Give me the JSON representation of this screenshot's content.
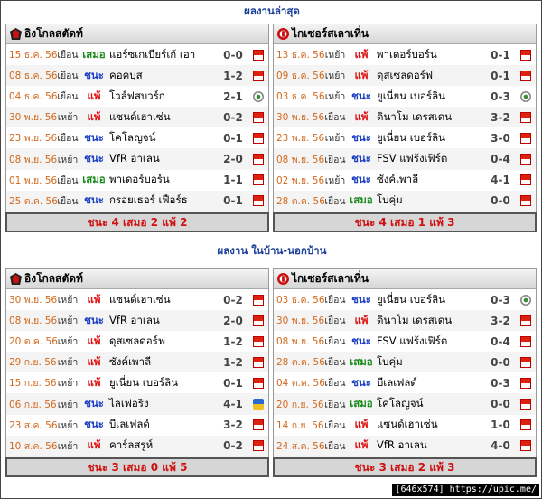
{
  "section1": {
    "title": "ผลงานล่าสุด",
    "left": {
      "team": "อิงโกลสตัดท์",
      "summary": "ชนะ 4 เสมอ 2 แพ้ 2",
      "rows": [
        {
          "date": "15 ธ.ค. 56",
          "venue": "เยือน",
          "result": "เสมอ",
          "rtype": "draw",
          "opponent": "แอร์ซเกเบียร์เก้ เอา",
          "score": "0-0",
          "comp": "bl"
        },
        {
          "date": "08 ธ.ค. 56",
          "venue": "เยือน",
          "result": "ชนะ",
          "rtype": "win",
          "opponent": "คอคบุส",
          "score": "1-2",
          "comp": "bl"
        },
        {
          "date": "04 ธ.ค. 56",
          "venue": "เยือน",
          "result": "แพ้",
          "rtype": "loss",
          "opponent": "โวล์ฟสบวร์ก",
          "score": "2-1",
          "comp": "cup"
        },
        {
          "date": "30 พ.ย. 56",
          "venue": "เหย้า",
          "result": "แพ้",
          "rtype": "loss",
          "opponent": "แซนด์เฮาเซ่น",
          "score": "0-2",
          "comp": "bl"
        },
        {
          "date": "23 พ.ย. 56",
          "venue": "เยือน",
          "result": "ชนะ",
          "rtype": "win",
          "opponent": "โคโลญจน์",
          "score": "0-1",
          "comp": "bl"
        },
        {
          "date": "08 พ.ย. 56",
          "venue": "เหย้า",
          "result": "ชนะ",
          "rtype": "win",
          "opponent": "VfR อาเลน",
          "score": "2-0",
          "comp": "bl"
        },
        {
          "date": "01 พ.ย. 56",
          "venue": "เยือน",
          "result": "เสมอ",
          "rtype": "draw",
          "opponent": "พาเดอร์บอร์น",
          "score": "1-1",
          "comp": "bl"
        },
        {
          "date": "25 ต.ค. 56",
          "venue": "เยือน",
          "result": "ชนะ",
          "rtype": "win",
          "opponent": "กรอยเธอร์ เฟือร์ธ",
          "score": "0-1",
          "comp": "bl"
        }
      ]
    },
    "right": {
      "team": "ไกเซอร์สเลาเทิ่น",
      "summary": "ชนะ 4 เสมอ 1 แพ้ 3",
      "rows": [
        {
          "date": "13 ธ.ค. 56",
          "venue": "เหย้า",
          "result": "แพ้",
          "rtype": "loss",
          "opponent": "พาเดอร์บอร์น",
          "score": "0-1",
          "comp": "bl"
        },
        {
          "date": "09 ธ.ค. 56",
          "venue": "เหย้า",
          "result": "แพ้",
          "rtype": "loss",
          "opponent": "ดุสเซลดอร์ฟ",
          "score": "0-1",
          "comp": "bl"
        },
        {
          "date": "03 ธ.ค. 56",
          "venue": "เหย้า",
          "result": "ชนะ",
          "rtype": "win",
          "opponent": "ยูเนี่ยน เบอร์ลิน",
          "score": "0-3",
          "comp": "cup"
        },
        {
          "date": "30 พ.ย. 56",
          "venue": "เยือน",
          "result": "แพ้",
          "rtype": "loss",
          "opponent": "ดินาโม เดรสเดน",
          "score": "3-2",
          "comp": "bl"
        },
        {
          "date": "23 พ.ย. 56",
          "venue": "เหย้า",
          "result": "ชนะ",
          "rtype": "win",
          "opponent": "ยูเนี่ยน เบอร์ลิน",
          "score": "3-0",
          "comp": "bl"
        },
        {
          "date": "08 พ.ย. 56",
          "venue": "เยือน",
          "result": "ชนะ",
          "rtype": "win",
          "opponent": "FSV แฟร้งเฟิร์ต",
          "score": "0-4",
          "comp": "bl"
        },
        {
          "date": "02 พ.ย. 56",
          "venue": "เหย้า",
          "result": "ชนะ",
          "rtype": "win",
          "opponent": "ซังค์เพาลี",
          "score": "4-1",
          "comp": "bl"
        },
        {
          "date": "28 ต.ค. 56",
          "venue": "เยือน",
          "result": "เสมอ",
          "rtype": "draw",
          "opponent": "โบคุ่ม",
          "score": "0-0",
          "comp": "bl"
        }
      ]
    }
  },
  "section2": {
    "title": "ผลงาน ในบ้าน-นอกบ้าน",
    "left": {
      "team": "อิงโกลสตัดท์",
      "summary": "ชนะ 3 เสมอ 0 แพ้ 5",
      "rows": [
        {
          "date": "30 พ.ย. 56",
          "venue": "เหย้า",
          "result": "แพ้",
          "rtype": "loss",
          "opponent": "แซนด์เฮาเซ่น",
          "score": "0-2",
          "comp": "bl"
        },
        {
          "date": "08 พ.ย. 56",
          "venue": "เหย้า",
          "result": "ชนะ",
          "rtype": "win",
          "opponent": "VfR อาเลน",
          "score": "2-0",
          "comp": "bl"
        },
        {
          "date": "20 ต.ค. 56",
          "venue": "เหย้า",
          "result": "แพ้",
          "rtype": "loss",
          "opponent": "ดุสเซลดอร์ฟ",
          "score": "1-2",
          "comp": "bl"
        },
        {
          "date": "29 ก.ย. 56",
          "venue": "เหย้า",
          "result": "แพ้",
          "rtype": "loss",
          "opponent": "ซังค์เพาลี",
          "score": "1-2",
          "comp": "bl"
        },
        {
          "date": "15 ก.ย. 56",
          "venue": "เหย้า",
          "result": "แพ้",
          "rtype": "loss",
          "opponent": "ยูเนี่ยน เบอร์ลิน",
          "score": "0-1",
          "comp": "bl"
        },
        {
          "date": "06 ก.ย. 56",
          "venue": "เหย้า",
          "result": "ชนะ",
          "rtype": "win",
          "opponent": "ไลเฟอริง",
          "score": "4-1",
          "comp": "fifa"
        },
        {
          "date": "23 ส.ค. 56",
          "venue": "เหย้า",
          "result": "ชนะ",
          "rtype": "win",
          "opponent": "บีเลเฟลด์",
          "score": "3-2",
          "comp": "bl"
        },
        {
          "date": "10 ส.ค. 56",
          "venue": "เหย้า",
          "result": "แพ้",
          "rtype": "loss",
          "opponent": "คาร์ลสรูห์",
          "score": "0-2",
          "comp": "bl"
        }
      ]
    },
    "right": {
      "team": "ไกเซอร์สเลาเทิ่น",
      "summary": "ชนะ 3 เสมอ 2 แพ้ 3",
      "rows": [
        {
          "date": "03 ธ.ค. 56",
          "venue": "เยือน",
          "result": "ชนะ",
          "rtype": "win",
          "opponent": "ยูเนี่ยน เบอร์ลิน",
          "score": "0-3",
          "comp": "cup"
        },
        {
          "date": "30 พ.ย. 56",
          "venue": "เยือน",
          "result": "แพ้",
          "rtype": "loss",
          "opponent": "ดินาโม เดรสเดน",
          "score": "3-2",
          "comp": "bl"
        },
        {
          "date": "08 พ.ย. 56",
          "venue": "เยือน",
          "result": "ชนะ",
          "rtype": "win",
          "opponent": "FSV แฟร้งเฟิร์ต",
          "score": "0-4",
          "comp": "bl"
        },
        {
          "date": "28 ต.ค. 56",
          "venue": "เยือน",
          "result": "เสมอ",
          "rtype": "draw",
          "opponent": "โบคุ่ม",
          "score": "0-0",
          "comp": "bl"
        },
        {
          "date": "04 ต.ค. 56",
          "venue": "เยือน",
          "result": "ชนะ",
          "rtype": "win",
          "opponent": "บีเลเฟลด์",
          "score": "0-3",
          "comp": "bl"
        },
        {
          "date": "20 ก.ย. 56",
          "venue": "เยือน",
          "result": "เสมอ",
          "rtype": "draw",
          "opponent": "โคโลญจน์",
          "score": "0-0",
          "comp": "bl"
        },
        {
          "date": "14 ก.ย. 56",
          "venue": "เยือน",
          "result": "แพ้",
          "rtype": "loss",
          "opponent": "แซนด์เฮาเซ่น",
          "score": "1-0",
          "comp": "bl"
        },
        {
          "date": "24 ส.ค. 56",
          "venue": "เยือน",
          "result": "แพ้",
          "rtype": "loss",
          "opponent": "VfR อาเลน",
          "score": "4-0",
          "comp": "bl"
        }
      ]
    }
  },
  "colors": {
    "win": "#1a3fc4",
    "draw": "#1a8a1a",
    "loss": "#e01010",
    "date": "#d2691e",
    "title": "#1c3f99"
  },
  "watermark": "[646x574] https://upic.me/"
}
